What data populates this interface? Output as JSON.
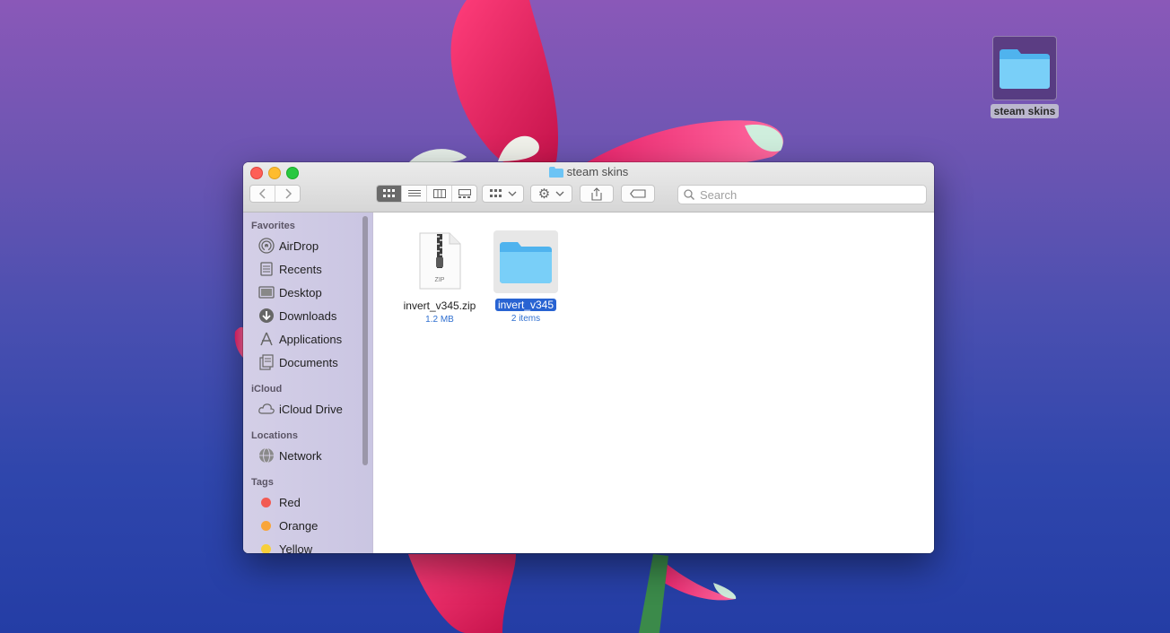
{
  "desktop": {
    "icon_label": "steam skins"
  },
  "window": {
    "title": "steam skins",
    "search_placeholder": "Search"
  },
  "sidebar": {
    "favorites_header": "Favorites",
    "favorites": [
      {
        "label": "AirDrop",
        "icon": "airdrop-icon"
      },
      {
        "label": "Recents",
        "icon": "recents-icon"
      },
      {
        "label": "Desktop",
        "icon": "desktop-icon"
      },
      {
        "label": "Downloads",
        "icon": "downloads-icon"
      },
      {
        "label": "Applications",
        "icon": "applications-icon"
      },
      {
        "label": "Documents",
        "icon": "documents-icon"
      }
    ],
    "icloud_header": "iCloud",
    "icloud": [
      {
        "label": "iCloud Drive",
        "icon": "cloud-icon"
      }
    ],
    "locations_header": "Locations",
    "locations": [
      {
        "label": "Network",
        "icon": "network-icon"
      }
    ],
    "tags_header": "Tags",
    "tags": [
      {
        "label": "Red",
        "color": "#f25a52"
      },
      {
        "label": "Orange",
        "color": "#f8a53a"
      },
      {
        "label": "Yellow",
        "color": "#f7cf3a"
      }
    ]
  },
  "files": [
    {
      "name": "invert_v345.zip",
      "meta": "1.2 MB",
      "type_label": "ZIP",
      "icon": "zip-file-icon"
    },
    {
      "name": "invert_v345",
      "meta": "2 items",
      "icon": "folder-icon",
      "selected": true
    }
  ],
  "colors": {
    "selection": "#2863d2",
    "folder": "#6cc4f5"
  }
}
